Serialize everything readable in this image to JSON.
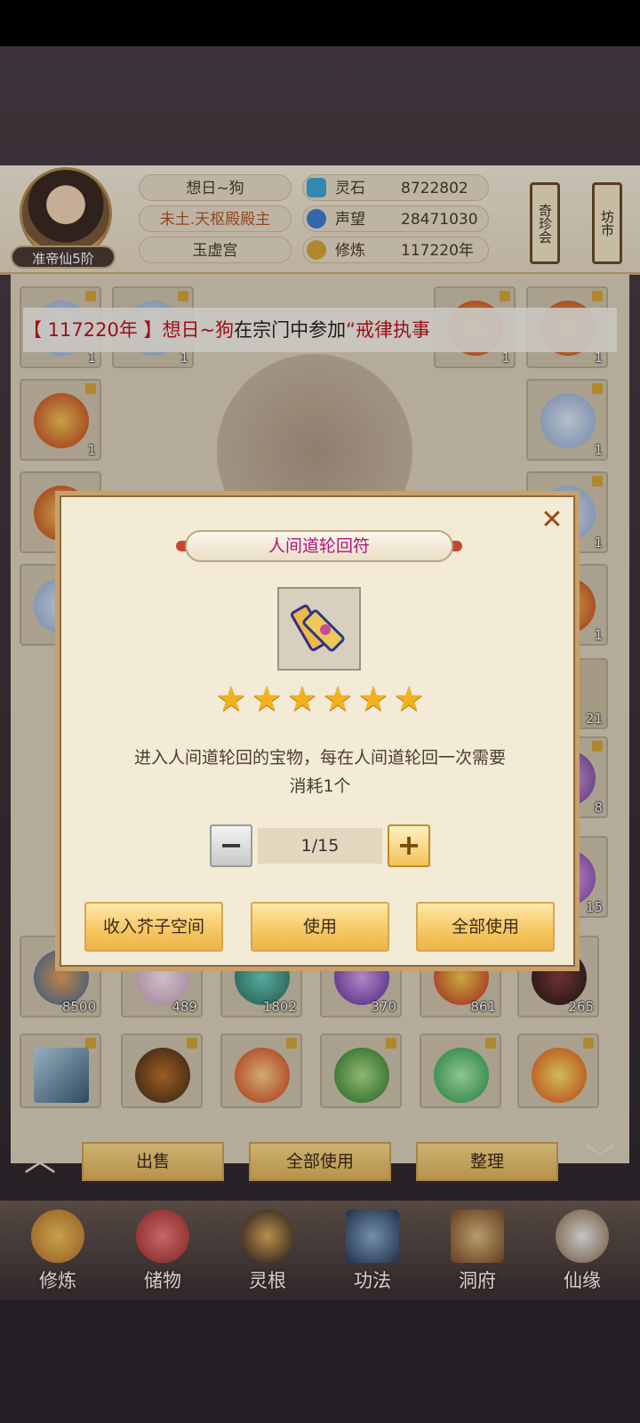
{
  "player": {
    "name": "想日~狗",
    "title": "未土.天枢殿殿主",
    "sect": "玉虚宫",
    "rank": "准帝仙5阶"
  },
  "stats": [
    {
      "label": "灵石",
      "value": "8722802",
      "icon": "spirit-stone-icon",
      "color": "#3fa6d9"
    },
    {
      "label": "声望",
      "value": "28471030",
      "icon": "reputation-icon",
      "color": "#3d7fd0"
    },
    {
      "label": "修炼",
      "value": "117220年",
      "icon": "meditation-icon",
      "color": "#d6a637"
    }
  ],
  "side_buttons": [
    "奇珍会",
    "坊市"
  ],
  "banner": {
    "prefix": "【 117220年 】",
    "name": "想日~狗",
    "mid": "在宗门中参加",
    "event": "“戒律执事"
  },
  "inventory": {
    "counts": [
      "1",
      "1",
      "1",
      "1",
      "1",
      "1",
      "1",
      "1",
      "1",
      "8",
      "15",
      "21"
    ],
    "row_counts": [
      "8500",
      "489",
      "1802",
      "370",
      "861",
      "265"
    ],
    "buttons": [
      "出售",
      "全部使用",
      "整理"
    ]
  },
  "modal": {
    "title": "人间道轮回符",
    "stars": 6,
    "star_glyph": "★",
    "description_line1": "进入人间道轮回的宝物，每在人间道轮回一次需要",
    "description_line2": "消耗1个",
    "quantity": "1/15",
    "minus": "−",
    "plus": "+",
    "close": "✕",
    "buttons": [
      "收入芥子空间",
      "使用",
      "全部使用"
    ]
  },
  "nav": [
    "修炼",
    "储物",
    "灵根",
    "功法",
    "洞府",
    "仙缘"
  ]
}
